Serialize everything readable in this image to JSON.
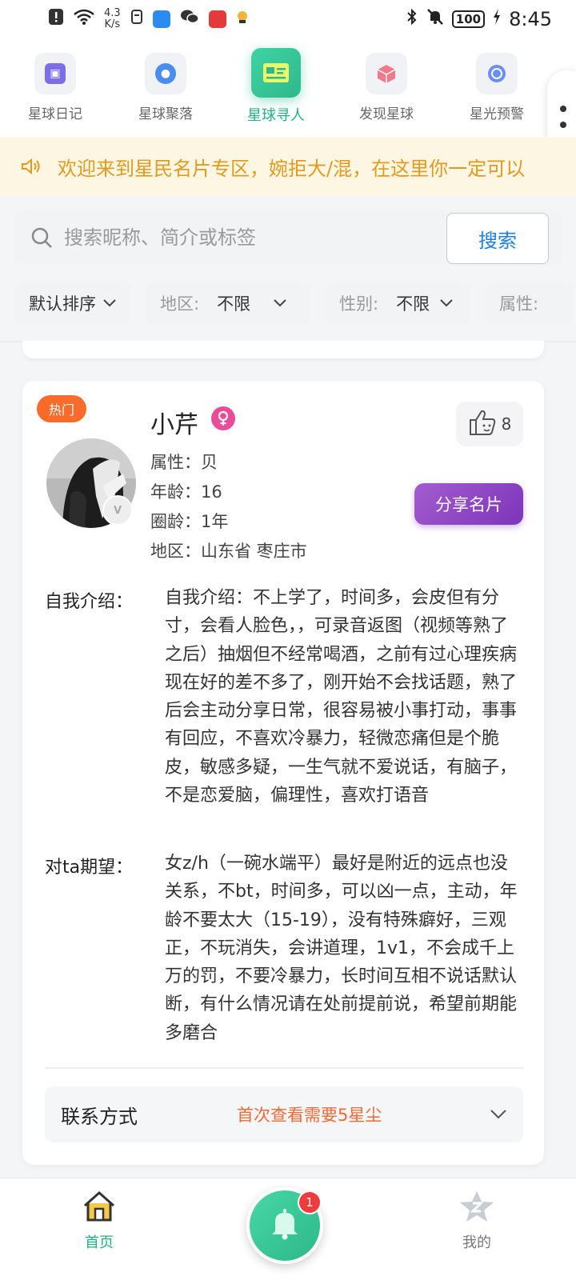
{
  "status_bar": {
    "net_speed_value": "4.3",
    "net_speed_unit": "K/s",
    "battery": "100",
    "time": "8:45"
  },
  "top_nav": {
    "items": [
      {
        "label": "星球日记",
        "icon": "diary-icon",
        "color": "#7b6fe8"
      },
      {
        "label": "星球聚落",
        "icon": "group-icon",
        "color": "#4a8cf0"
      },
      {
        "label": "星球寻人",
        "icon": "id-card-icon",
        "color": "#2fb98b",
        "active": true
      },
      {
        "label": "发现星球",
        "icon": "cube-icon",
        "color": "#f07a8c"
      },
      {
        "label": "星光预警",
        "icon": "alarm-icon",
        "color": "#6a8ef2"
      }
    ]
  },
  "notice": {
    "text": "欢迎来到星民名片专区，婉拒大/混，在这里你一定可以"
  },
  "search": {
    "placeholder": "搜索昵称、简介或标签",
    "button_label": "搜索"
  },
  "filters": {
    "sort_label": "默认排序",
    "region_label": "地区:",
    "region_value": "不限",
    "gender_label": "性别:",
    "gender_value": "不限",
    "attr_label": "属性:"
  },
  "card": {
    "badge": "热门",
    "name": "小芹",
    "likes": "8",
    "attr_line": "属性：贝",
    "age_line": "年龄：16",
    "circle_line": "圈龄：1年",
    "region_line": "地区：山东省 枣庄市",
    "share_label": "分享名片",
    "intro_label": "自我介绍：",
    "intro_text": "自我介绍：不上学了，时间多，会皮但有分寸，会看人脸色，，可录音返图（视频等熟了之后）抽烟但不经常喝酒，之前有过心理疾病现在好的差不多了，刚开始不会找话题，熟了后会主动分享日常，很容易被小事打动，事事有回应，不喜欢冷暴力，轻微恋痛但是个脆皮，敏感多疑，一生气就不爱说话，有脑子，不是恋爱脑，偏理性，喜欢打语音",
    "expect_label": "对ta期望：",
    "expect_text": "女z/h（一碗水端平）最好是附近的远点也没关系，不bt，时间多，可以凶一点，主动，年龄不要太大（15-19），没有特殊癖好，三观正，不玩消失，会讲道理，1v1，不会成千上万的罚，不要冷暴力，长时间互相不说话默认断，有什么情况请在处前提前说，希望前期能多磨合",
    "contact_label": "联系方式",
    "contact_note": "首次查看需要5星尘"
  },
  "tab_bar": {
    "home_label": "首页",
    "me_label": "我的",
    "bell_badge": "1"
  },
  "colors": {
    "accent_green": "#21b37f",
    "notice_orange": "#e59a1d",
    "share_purple": "#8e44c4",
    "hot_orange": "#fa6a2b"
  }
}
